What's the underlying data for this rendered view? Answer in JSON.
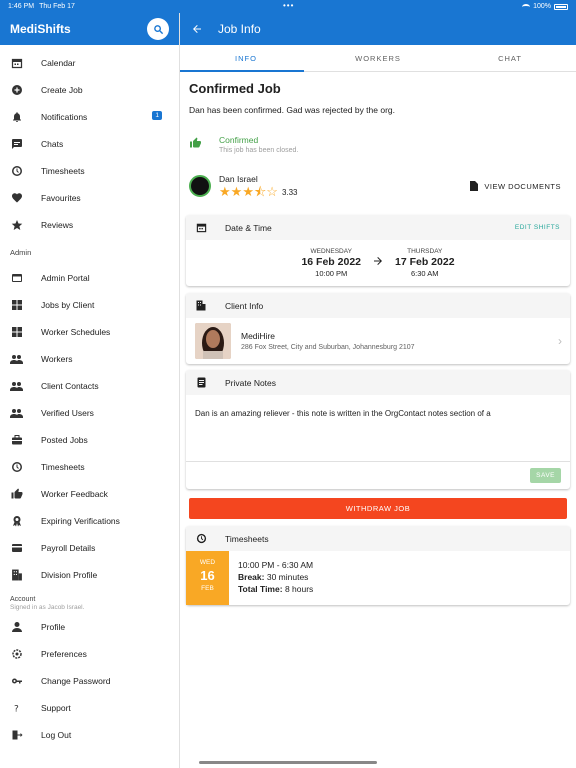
{
  "status_bar": {
    "time": "1:46 PM",
    "date": "Thu Feb 17",
    "battery": "100%"
  },
  "sidebar": {
    "brand": "MediShifts",
    "items_main": [
      {
        "label": "Calendar",
        "icon": "calendar-icon"
      },
      {
        "label": "Create Job",
        "icon": "add-circle-icon"
      },
      {
        "label": "Notifications",
        "icon": "bell-icon",
        "badge": "1"
      },
      {
        "label": "Chats",
        "icon": "chat-icon"
      },
      {
        "label": "Timesheets",
        "icon": "clock-icon"
      },
      {
        "label": "Favourites",
        "icon": "heart-icon"
      },
      {
        "label": "Reviews",
        "icon": "star-icon"
      }
    ],
    "admin_label": "Admin",
    "items_admin": [
      {
        "label": "Admin Portal",
        "icon": "portal-icon"
      },
      {
        "label": "Jobs by Client",
        "icon": "grid-icon"
      },
      {
        "label": "Worker Schedules",
        "icon": "grid-icon"
      },
      {
        "label": "Workers",
        "icon": "people-icon"
      },
      {
        "label": "Client Contacts",
        "icon": "people-icon"
      },
      {
        "label": "Verified Users",
        "icon": "people-icon"
      },
      {
        "label": "Posted Jobs",
        "icon": "briefcase-icon"
      },
      {
        "label": "Timesheets",
        "icon": "clock-icon"
      },
      {
        "label": "Worker Feedback",
        "icon": "thumbs-icon"
      },
      {
        "label": "Expiring Verifications",
        "icon": "award-icon"
      },
      {
        "label": "Payroll Details",
        "icon": "card-icon"
      },
      {
        "label": "Division Profile",
        "icon": "building-icon"
      }
    ],
    "account_label": "Account",
    "account_sub": "Signed in as Jacob Israel.",
    "items_account": [
      {
        "label": "Profile",
        "icon": "person-icon"
      },
      {
        "label": "Preferences",
        "icon": "settings-icon"
      },
      {
        "label": "Change Password",
        "icon": "key-icon"
      },
      {
        "label": "Support",
        "icon": "question-icon"
      },
      {
        "label": "Log Out",
        "icon": "logout-icon"
      }
    ]
  },
  "header": {
    "title": "Job Info"
  },
  "tabs": [
    "INFO",
    "WORKERS",
    "CHAT"
  ],
  "job": {
    "title": "Confirmed Job",
    "description": "Dan has been confirmed. Gad was rejected by the org.",
    "status_title": "Confirmed",
    "status_sub": "This job has been closed.",
    "status_color": "#43a047"
  },
  "worker": {
    "name": "Dan Israel",
    "rating": "3.33",
    "stars_filled": 3.33,
    "view_docs": "VIEW DOCUMENTS"
  },
  "datetime": {
    "title": "Date & Time",
    "edit": "EDIT SHIFTS",
    "start": {
      "weekday": "WEDNESDAY",
      "date": "16 Feb 2022",
      "time": "10:00 PM"
    },
    "end": {
      "weekday": "THURSDAY",
      "date": "17 Feb 2022",
      "time": "6:30 AM"
    }
  },
  "client": {
    "title": "Client Info",
    "name": "MediHire",
    "address": "286 Fox Street, City and Suburban, Johannesburg 2107"
  },
  "notes": {
    "title": "Private Notes",
    "text": "Dan is an amazing reliever - this note is written in the OrgContact notes section of a",
    "save": "SAVE"
  },
  "withdraw_label": "WITHDRAW JOB",
  "timesheets": {
    "title": "Timesheets",
    "weekday": "WED",
    "day": "16",
    "month": "FEB",
    "time_range": "10:00 PM - 6:30 AM",
    "break_label": "Break:",
    "break_value": "30 minutes",
    "total_label": "Total Time:",
    "total_value": "8 hours"
  },
  "colors": {
    "primary": "#1976d2",
    "danger": "#f4461f",
    "accent": "#f9a825",
    "success": "#43a047",
    "teal": "#26a69a"
  }
}
